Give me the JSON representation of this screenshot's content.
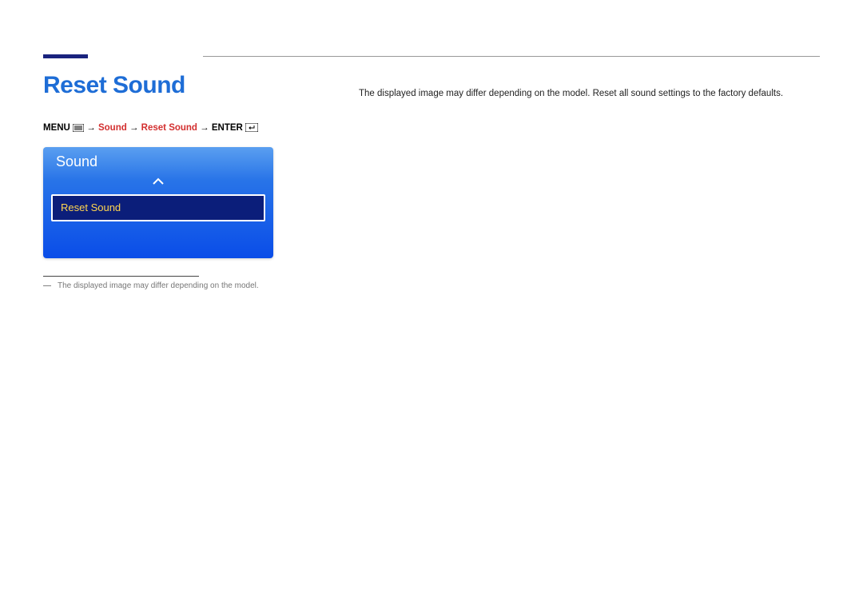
{
  "header": {
    "title": "Reset Sound"
  },
  "breadcrumb": {
    "menu_label": "MENU",
    "arrow": "→",
    "item1": "Sound",
    "item2": "Reset Sound",
    "enter_label": "ENTER"
  },
  "menu_panel": {
    "title": "Sound",
    "highlighted_item": "Reset Sound"
  },
  "footnote": {
    "text": "The displayed image may differ depending on the model."
  },
  "description": {
    "text": "The displayed image may differ depending on the model. Reset all sound settings to the factory defaults."
  }
}
